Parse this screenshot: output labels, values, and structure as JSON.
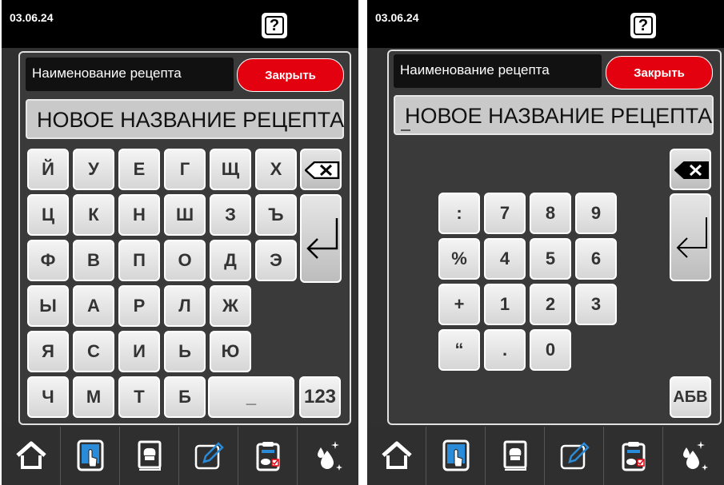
{
  "left": {
    "date": "03.06.24",
    "help_label": "?",
    "name_label": "Наименование рецепта",
    "close_label": "Закрыть",
    "name_value": "НОВОЕ НАЗВАНИЕ РЕЦЕПТА",
    "keys": [
      "Й",
      "У",
      "Е",
      "Г",
      "Щ",
      "Х",
      "Ц",
      "К",
      "Н",
      "Ш",
      "З",
      "Ъ",
      "Ф",
      "В",
      "П",
      "О",
      "Д",
      "Э",
      "Ы",
      "А",
      "Р",
      "Л",
      "Ж",
      "Я",
      "С",
      "И",
      "Ь",
      "Ю",
      "Ч",
      "М",
      "Т",
      "Б"
    ],
    "space_label": "_",
    "mode_label": "123"
  },
  "right": {
    "date": "03.06.24",
    "help_label": "?",
    "name_label": "Наименование рецепта",
    "close_label": "Закрыть",
    "name_value": "НОВОЕ НАЗВАНИЕ РЕЦЕПТА",
    "keys": [
      ":",
      "7",
      "8",
      "9",
      "%",
      "4",
      "5",
      "6",
      "+",
      "1",
      "2",
      "3",
      "“",
      ".",
      "0"
    ],
    "mode_label": "АБВ"
  },
  "icons": {
    "backspace": "backspace-icon",
    "enter": "enter-icon",
    "tabs": [
      "home-icon",
      "touch-tablet-icon",
      "cookbook-icon",
      "edit-icon",
      "clipboard-chicken-icon",
      "clean-drops-icon"
    ]
  },
  "colors": {
    "close": "#e3000f",
    "background": "#303030",
    "accent_blue": "#2a8bd8"
  }
}
